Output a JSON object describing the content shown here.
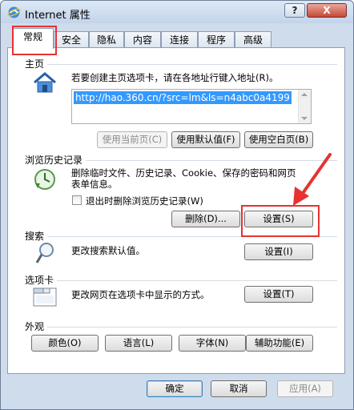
{
  "window": {
    "title": "Internet 属性",
    "help_label": "?",
    "close_label": "X"
  },
  "tabs": [
    {
      "label": "常规"
    },
    {
      "label": "安全"
    },
    {
      "label": "隐私"
    },
    {
      "label": "内容"
    },
    {
      "label": "连接"
    },
    {
      "label": "程序"
    },
    {
      "label": "高级"
    }
  ],
  "homepage": {
    "group_label": "主页",
    "description": "若要创建主页选项卡，请在各地址行键入地址(R)。",
    "url": "http://hao.360.cn/?src=lm&ls=n4abc0a4199",
    "use_current": "使用当前页(C)",
    "use_default": "使用默认值(F)",
    "use_blank": "使用空白页(B)"
  },
  "history": {
    "group_label": "浏览历史记录",
    "description_line1": "删除临时文件、历史记录、Cookie、保存的密码和网页",
    "description_line2": "表单信息。",
    "checkbox_label": "退出时删除浏览历史记录(W)",
    "checkbox_checked": false,
    "delete_button": "删除(D)...",
    "settings_button": "设置(S)"
  },
  "search": {
    "group_label": "搜索",
    "description": "更改搜索默认值。",
    "settings_button": "设置(I)"
  },
  "tabs_section": {
    "group_label": "选项卡",
    "description": "更改网页在选项卡中显示的方式。",
    "settings_button": "设置(T)"
  },
  "appearance": {
    "group_label": "外观",
    "colors": "颜色(O)",
    "languages": "语言(L)",
    "fonts": "字体(N)",
    "accessibility": "辅助功能(E)"
  },
  "footer": {
    "ok": "确定",
    "cancel": "取消",
    "apply": "应用(A)"
  },
  "colors": {
    "highlight_red": "#e63232",
    "url_selection": "#3399ff"
  }
}
